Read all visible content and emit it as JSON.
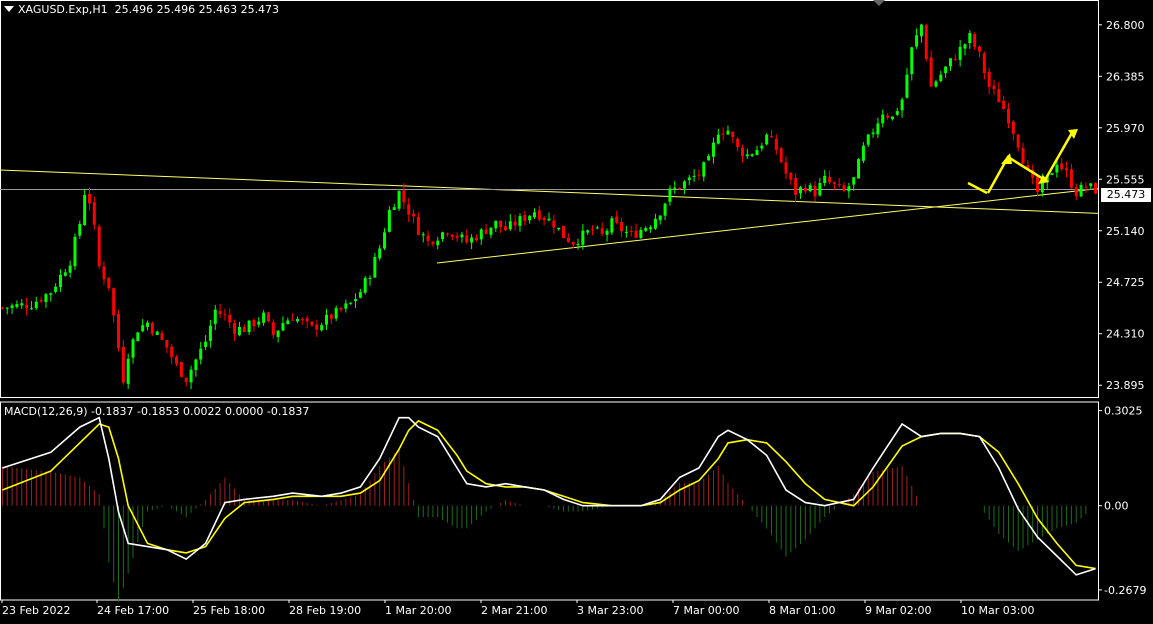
{
  "header": {
    "symbol": "XAGUSD.Exp,H1",
    "ohlc": "25.496 25.496 25.463 25.473"
  },
  "indicator": {
    "label": "MACD(12,26,9)",
    "values": "-0.1837 -0.1853 0.0022 0.0000 -0.1837"
  },
  "current_price_label": "25.473",
  "colors": {
    "background": "#000000",
    "bull": "#00ff00",
    "bear": "#ff0000",
    "hist_pos": "#a02020",
    "hist_neg": "#1e6b1e",
    "trendline": "#ffff66",
    "macd_line": "#ffffff",
    "signal_line": "#ffff00",
    "arrow": "#ffff00",
    "grid_text": "#ffffff"
  },
  "chart_data": [
    {
      "type": "candlestick",
      "title": "XAGUSD.Exp,H1",
      "y_ticks": [
        "26.800",
        "26.385",
        "25.970",
        "25.555",
        "25.140",
        "24.725",
        "24.310",
        "23.895"
      ],
      "ylim": [
        23.8,
        27.0
      ],
      "x_ticks": [
        "23 Feb 2022",
        "24 Feb 17:00",
        "25 Feb 18:00",
        "28 Feb 19:00",
        "1 Mar 20:00",
        "2 Mar 21:00",
        "3 Mar 23:00",
        "7 Mar 00:00",
        "8 Mar 01:00",
        "9 Mar 02:00",
        "10 Mar 03:00"
      ],
      "close_path": [
        [
          0,
          24.52
        ],
        [
          6,
          24.55
        ],
        [
          10,
          24.65
        ],
        [
          14,
          24.9
        ],
        [
          16,
          25.2
        ],
        [
          17,
          25.45
        ],
        [
          18,
          25.38
        ],
        [
          19,
          25.15
        ],
        [
          20,
          24.85
        ],
        [
          22,
          24.7
        ],
        [
          24,
          24.2
        ],
        [
          25,
          23.95
        ],
        [
          26,
          24.15
        ],
        [
          28,
          24.35
        ],
        [
          30,
          24.4
        ],
        [
          32,
          24.3
        ],
        [
          34,
          24.2
        ],
        [
          36,
          24.05
        ],
        [
          38,
          23.95
        ],
        [
          40,
          24.1
        ],
        [
          42,
          24.25
        ],
        [
          44,
          24.5
        ],
        [
          46,
          24.45
        ],
        [
          48,
          24.35
        ],
        [
          50,
          24.35
        ],
        [
          52,
          24.4
        ],
        [
          54,
          24.45
        ],
        [
          56,
          24.3
        ],
        [
          58,
          24.4
        ],
        [
          60,
          24.45
        ],
        [
          62,
          24.4
        ],
        [
          64,
          24.35
        ],
        [
          66,
          24.4
        ],
        [
          68,
          24.45
        ],
        [
          70,
          24.5
        ],
        [
          72,
          24.55
        ],
        [
          74,
          24.65
        ],
        [
          76,
          24.8
        ],
        [
          78,
          25.0
        ],
        [
          80,
          25.3
        ],
        [
          82,
          25.45
        ],
        [
          84,
          25.3
        ],
        [
          86,
          25.15
        ],
        [
          88,
          25.05
        ],
        [
          90,
          25.1
        ],
        [
          92,
          25.15
        ],
        [
          94,
          25.1
        ],
        [
          96,
          25.05
        ],
        [
          98,
          25.1
        ],
        [
          100,
          25.15
        ],
        [
          102,
          25.2
        ],
        [
          104,
          25.15
        ],
        [
          106,
          25.2
        ],
        [
          108,
          25.25
        ],
        [
          110,
          25.3
        ],
        [
          112,
          25.25
        ],
        [
          114,
          25.2
        ],
        [
          116,
          25.1
        ],
        [
          118,
          25.05
        ],
        [
          120,
          25.1
        ],
        [
          122,
          25.15
        ],
        [
          124,
          25.1
        ],
        [
          126,
          25.2
        ],
        [
          128,
          25.15
        ],
        [
          130,
          25.1
        ],
        [
          132,
          25.15
        ],
        [
          134,
          25.2
        ],
        [
          136,
          25.3
        ],
        [
          138,
          25.45
        ],
        [
          140,
          25.5
        ],
        [
          142,
          25.55
        ],
        [
          144,
          25.6
        ],
        [
          146,
          25.7
        ],
        [
          148,
          25.95
        ],
        [
          150,
          25.95
        ],
        [
          152,
          25.8
        ],
        [
          154,
          25.75
        ],
        [
          156,
          25.8
        ],
        [
          158,
          25.9
        ],
        [
          160,
          25.8
        ],
        [
          162,
          25.6
        ],
        [
          164,
          25.45
        ],
        [
          166,
          25.5
        ],
        [
          168,
          25.45
        ],
        [
          170,
          25.55
        ],
        [
          172,
          25.5
        ],
        [
          174,
          25.45
        ],
        [
          176,
          25.55
        ],
        [
          178,
          25.8
        ],
        [
          180,
          25.95
        ],
        [
          182,
          26.1
        ],
        [
          184,
          26.05
        ],
        [
          186,
          26.2
        ],
        [
          188,
          26.6
        ],
        [
          190,
          26.8
        ],
        [
          192,
          26.3
        ],
        [
          194,
          26.4
        ],
        [
          196,
          26.5
        ],
        [
          198,
          26.6
        ],
        [
          200,
          26.7
        ],
        [
          202,
          26.55
        ],
        [
          204,
          26.3
        ],
        [
          206,
          26.2
        ],
        [
          208,
          26.05
        ],
        [
          210,
          25.85
        ],
        [
          212,
          25.6
        ],
        [
          214,
          25.45
        ],
        [
          216,
          25.55
        ],
        [
          218,
          25.7
        ],
        [
          220,
          25.6
        ],
        [
          222,
          25.45
        ],
        [
          224,
          25.5
        ],
        [
          226,
          25.47
        ]
      ]
    },
    {
      "type": "line",
      "title": "MACD(12,26,9)",
      "y_ticks": [
        "0.3025",
        "0.00",
        "-0.2679"
      ],
      "ylim": [
        -0.3,
        0.33
      ],
      "series": [
        {
          "values": [
            [
              0,
              0.12
            ],
            [
              10,
              0.17
            ],
            [
              16,
              0.25
            ],
            [
              20,
              0.28
            ],
            [
              22,
              0.15
            ],
            [
              24,
              -0.02
            ],
            [
              26,
              -0.12
            ],
            [
              30,
              -0.13
            ],
            [
              34,
              -0.14
            ],
            [
              38,
              -0.17
            ],
            [
              42,
              -0.12
            ],
            [
              46,
              0.01
            ],
            [
              50,
              0.02
            ],
            [
              56,
              0.03
            ],
            [
              60,
              0.04
            ],
            [
              66,
              0.03
            ],
            [
              70,
              0.04
            ],
            [
              74,
              0.06
            ],
            [
              78,
              0.15
            ],
            [
              82,
              0.28
            ],
            [
              84,
              0.28
            ],
            [
              86,
              0.25
            ],
            [
              90,
              0.22
            ],
            [
              94,
              0.12
            ],
            [
              96,
              0.07
            ],
            [
              100,
              0.06
            ],
            [
              104,
              0.07
            ],
            [
              108,
              0.06
            ],
            [
              112,
              0.05
            ],
            [
              116,
              0.02
            ],
            [
              120,
              0.0
            ],
            [
              126,
              0.0
            ],
            [
              132,
              0.0
            ],
            [
              136,
              0.02
            ],
            [
              140,
              0.09
            ],
            [
              144,
              0.12
            ],
            [
              148,
              0.22
            ],
            [
              150,
              0.24
            ],
            [
              154,
              0.21
            ],
            [
              158,
              0.16
            ],
            [
              162,
              0.05
            ],
            [
              166,
              0.01
            ],
            [
              170,
              0.0
            ],
            [
              176,
              0.02
            ],
            [
              180,
              0.12
            ],
            [
              186,
              0.26
            ],
            [
              190,
              0.22
            ],
            [
              194,
              0.23
            ],
            [
              198,
              0.23
            ],
            [
              202,
              0.22
            ],
            [
              206,
              0.12
            ],
            [
              210,
              -0.01
            ],
            [
              214,
              -0.1
            ],
            [
              218,
              -0.16
            ],
            [
              222,
              -0.22
            ],
            [
              226,
              -0.2
            ]
          ]
        },
        {
          "values": [
            [
              0,
              0.05
            ],
            [
              10,
              0.11
            ],
            [
              16,
              0.2
            ],
            [
              20,
              0.26
            ],
            [
              22,
              0.25
            ],
            [
              24,
              0.15
            ],
            [
              26,
              0.0
            ],
            [
              30,
              -0.12
            ],
            [
              34,
              -0.14
            ],
            [
              38,
              -0.15
            ],
            [
              42,
              -0.13
            ],
            [
              46,
              -0.04
            ],
            [
              50,
              0.01
            ],
            [
              56,
              0.02
            ],
            [
              60,
              0.03
            ],
            [
              66,
              0.03
            ],
            [
              70,
              0.03
            ],
            [
              74,
              0.04
            ],
            [
              78,
              0.08
            ],
            [
              82,
              0.18
            ],
            [
              84,
              0.24
            ],
            [
              86,
              0.27
            ],
            [
              90,
              0.24
            ],
            [
              94,
              0.16
            ],
            [
              96,
              0.11
            ],
            [
              100,
              0.07
            ],
            [
              104,
              0.06
            ],
            [
              108,
              0.06
            ],
            [
              112,
              0.05
            ],
            [
              116,
              0.03
            ],
            [
              120,
              0.01
            ],
            [
              126,
              0.0
            ],
            [
              132,
              0.0
            ],
            [
              136,
              0.01
            ],
            [
              140,
              0.05
            ],
            [
              144,
              0.08
            ],
            [
              148,
              0.15
            ],
            [
              150,
              0.2
            ],
            [
              154,
              0.21
            ],
            [
              158,
              0.2
            ],
            [
              162,
              0.14
            ],
            [
              166,
              0.07
            ],
            [
              170,
              0.02
            ],
            [
              176,
              0.0
            ],
            [
              180,
              0.06
            ],
            [
              186,
              0.19
            ],
            [
              190,
              0.22
            ],
            [
              194,
              0.23
            ],
            [
              198,
              0.23
            ],
            [
              202,
              0.22
            ],
            [
              206,
              0.17
            ],
            [
              210,
              0.07
            ],
            [
              214,
              -0.04
            ],
            [
              218,
              -0.12
            ],
            [
              222,
              -0.19
            ],
            [
              226,
              -0.2
            ]
          ]
        }
      ]
    }
  ]
}
